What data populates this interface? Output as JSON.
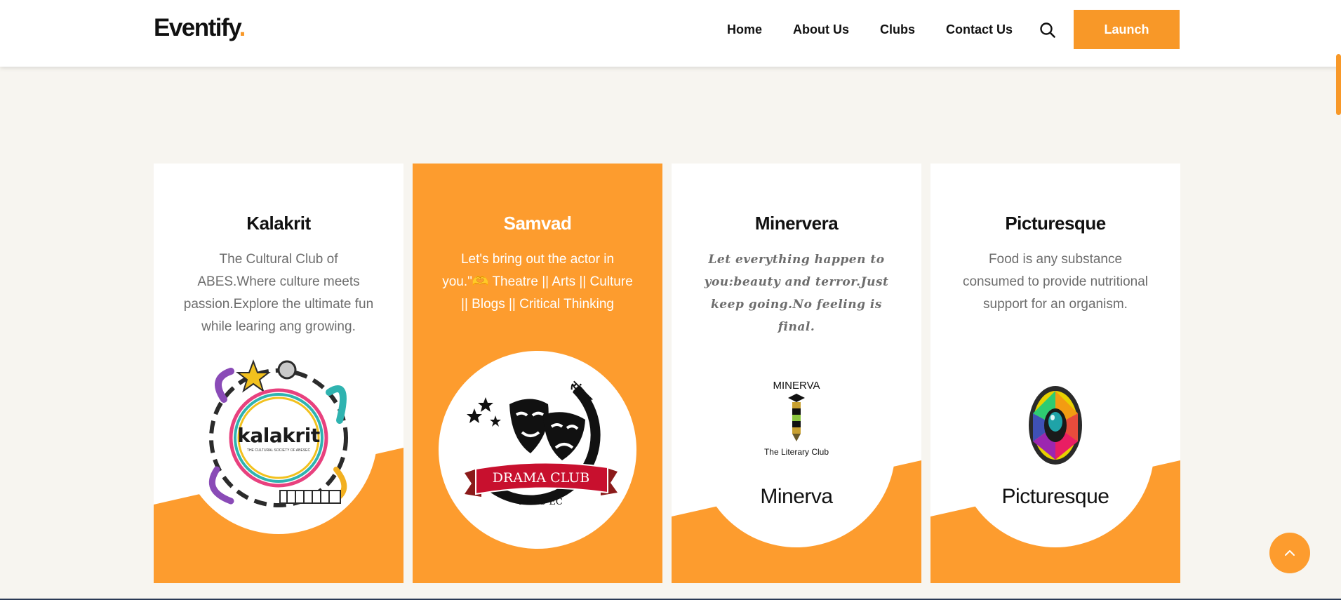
{
  "header": {
    "logo_text": "Eventify",
    "logo_dot": ".",
    "nav": [
      "Home",
      "About Us",
      "Clubs",
      "Contact Us"
    ],
    "launch_label": "Launch"
  },
  "colors": {
    "accent": "#f89828",
    "card_active": "#fd9c2e",
    "background": "#f7f5f0"
  },
  "cards": [
    {
      "title": "Kalakrit",
      "description": "The Cultural Club of ABES.Where culture meets passion.Explore the ultimate fun while learing ang growing.",
      "logo_text": "kalakrit",
      "logo_subtext": "THE CULTURAL SOCIETY OF ABESEC"
    },
    {
      "title": "Samvad",
      "description": "Let's bring out the actor in you.\"🫶 Theatre || Arts || Culture || Blogs || Critical Thinking",
      "logo_banner": "DRAMA CLUB",
      "logo_subtext": "ABES-EC",
      "logo_hindi": "संवाद"
    },
    {
      "title": "Minervera",
      "description": "Let everything happen to you:beauty and terror.Just keep going.No feeling is final.",
      "logo_top": "MINERVA",
      "logo_sub": "The Literary Club",
      "logo_name": "Minerva"
    },
    {
      "title": "Picturesque",
      "description": "Food is any substance consumed to provide nutritional support for an organism.",
      "logo_name": "Picturesque"
    }
  ]
}
